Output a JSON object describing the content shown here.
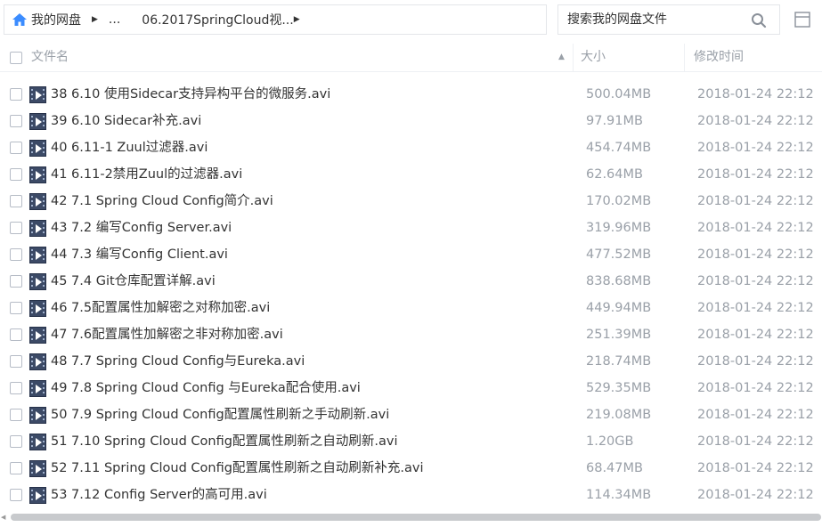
{
  "breadcrumb": {
    "home": "我的网盘",
    "ellipsis": "...",
    "current": "06.2017SpringCloud视..."
  },
  "search": {
    "placeholder": "搜索我的网盘文件"
  },
  "columns": {
    "name": "文件名",
    "size": "大小",
    "time": "修改时间"
  },
  "sort": {
    "column": "name",
    "direction": "asc"
  },
  "colors": {
    "accent": "#3b8cff",
    "muted_text": "#9aa0a8",
    "icon_bg": "#3c4a66"
  },
  "partial_row": {
    "time": "2018-01-24 22:12"
  },
  "files": [
    {
      "name": "38 6.10 使用Sidecar支持异构平台的微服务.avi",
      "size": "500.04MB",
      "time": "2018-01-24 22:12"
    },
    {
      "name": "39 6.10 Sidecar补充.avi",
      "size": "97.91MB",
      "time": "2018-01-24 22:12"
    },
    {
      "name": "40 6.11-1 Zuul过滤器.avi",
      "size": "454.74MB",
      "time": "2018-01-24 22:12"
    },
    {
      "name": "41 6.11-2禁用Zuul的过滤器.avi",
      "size": "62.64MB",
      "time": "2018-01-24 22:12"
    },
    {
      "name": "42 7.1 Spring Cloud Config简介.avi",
      "size": "170.02MB",
      "time": "2018-01-24 22:12"
    },
    {
      "name": "43 7.2 编写Config Server.avi",
      "size": "319.96MB",
      "time": "2018-01-24 22:12"
    },
    {
      "name": "44 7.3 编写Config Client.avi",
      "size": "477.52MB",
      "time": "2018-01-24 22:12"
    },
    {
      "name": "45 7.4 Git仓库配置详解.avi",
      "size": "838.68MB",
      "time": "2018-01-24 22:12"
    },
    {
      "name": "46 7.5配置属性加解密之对称加密.avi",
      "size": "449.94MB",
      "time": "2018-01-24 22:12"
    },
    {
      "name": "47 7.6配置属性加解密之非对称加密.avi",
      "size": "251.39MB",
      "time": "2018-01-24 22:12"
    },
    {
      "name": "48 7.7 Spring Cloud Config与Eureka.avi",
      "size": "218.74MB",
      "time": "2018-01-24 22:12"
    },
    {
      "name": "49 7.8 Spring Cloud Config 与Eureka配合使用.avi",
      "size": "529.35MB",
      "time": "2018-01-24 22:12"
    },
    {
      "name": "50 7.9 Spring Cloud Config配置属性刷新之手动刷新.avi",
      "size": "219.08MB",
      "time": "2018-01-24 22:12"
    },
    {
      "name": "51 7.10 Spring Cloud Config配置属性刷新之自动刷新.avi",
      "size": "1.20GB",
      "time": "2018-01-24 22:12"
    },
    {
      "name": "52 7.11 Spring Cloud Config配置属性刷新之自动刷新补充.avi",
      "size": "68.47MB",
      "time": "2018-01-24 22:12"
    },
    {
      "name": "53 7.12 Config Server的高可用.avi",
      "size": "114.34MB",
      "time": "2018-01-24 22:12"
    }
  ]
}
